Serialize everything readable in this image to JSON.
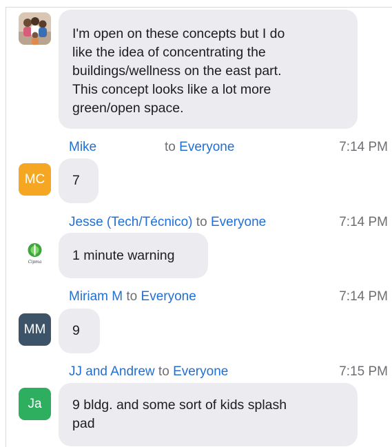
{
  "messages": [
    {
      "avatar_icon": "family-photo-icon",
      "lines": [
        "I'm open on these concepts but I do",
        "like the idea of concentrating the",
        "buildings/wellness on the east part.",
        "This concept looks like a lot more",
        "green/open space."
      ]
    },
    {
      "sender": "Mike",
      "to": "to",
      "recipient": "Everyone",
      "time": "7:14 PM",
      "avatar_initials": "MC",
      "avatar_color": "#f5a623",
      "lines": [
        "7"
      ]
    },
    {
      "sender": "Jesse (Tech/Técnico)",
      "to": "to",
      "recipient": "Everyone",
      "time": "7:14 PM",
      "avatar_icon": "organization-logo-icon",
      "avatar_logo_text": "Cipma",
      "lines": [
        "1 minute warning"
      ]
    },
    {
      "sender": "Miriam M",
      "to": "to",
      "recipient": "Everyone",
      "time": "7:14 PM",
      "avatar_initials": "MM",
      "avatar_color": "#3d5468",
      "lines": [
        "9"
      ]
    },
    {
      "sender": "JJ and Andrew",
      "to": "to",
      "recipient": "Everyone",
      "time": "7:15 PM",
      "avatar_initials": "Ja",
      "avatar_color": "#2eae5f",
      "lines": [
        "9 bldg. and some sort of kids splash",
        "pad"
      ]
    }
  ]
}
